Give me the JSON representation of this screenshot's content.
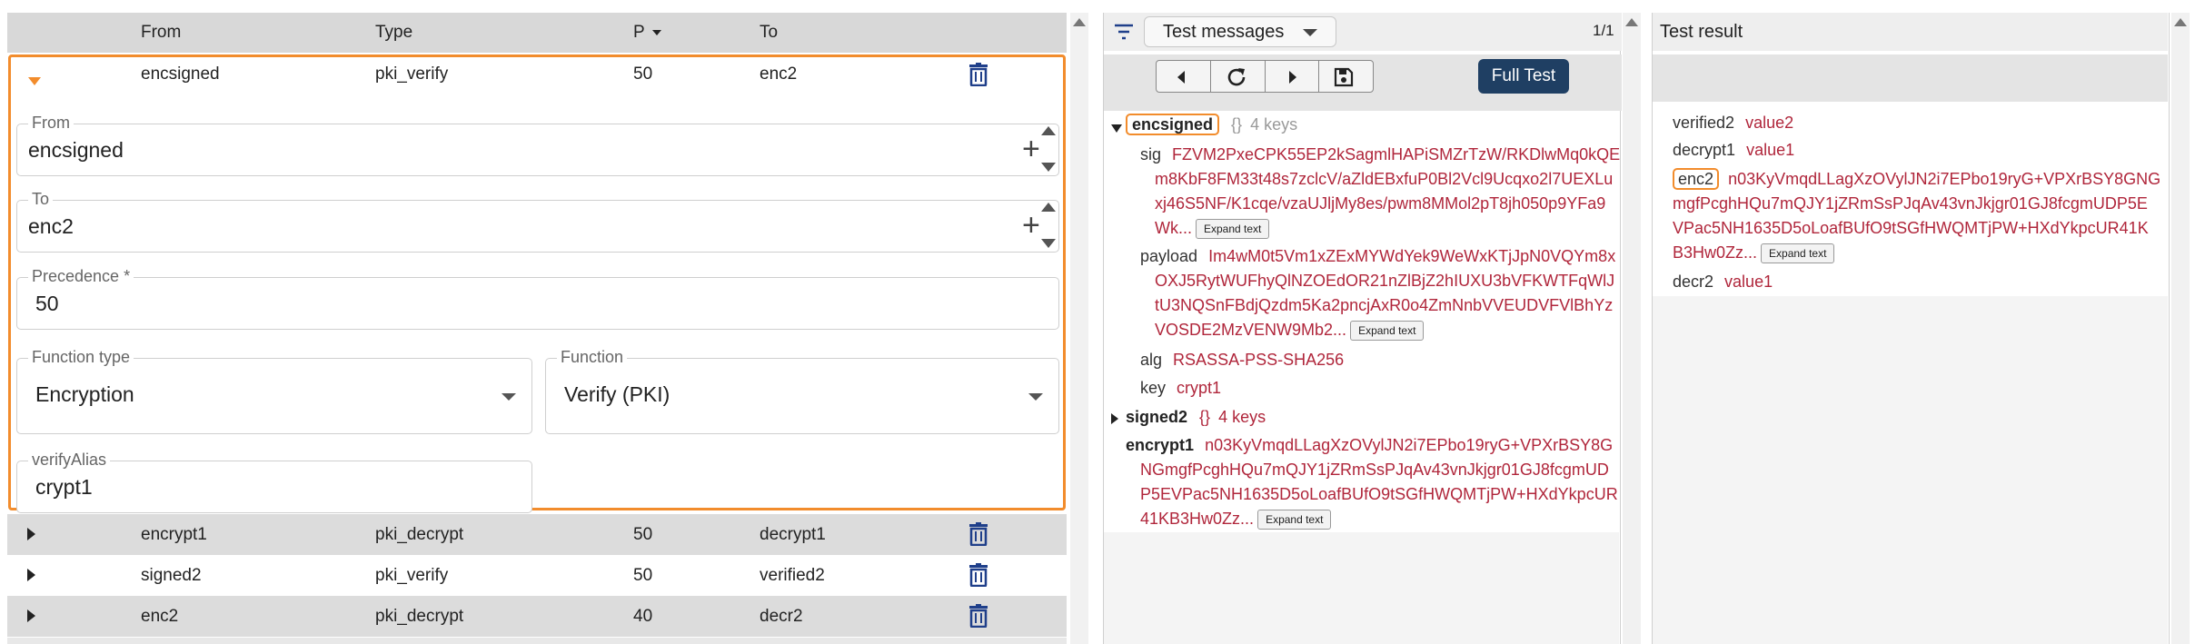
{
  "table": {
    "headers": {
      "from": "From",
      "type": "Type",
      "precedence": "P",
      "to": "To"
    },
    "expanded_row": {
      "from": "encsigned",
      "type": "pki_verify",
      "precedence": "50",
      "to": "enc2"
    },
    "form": {
      "from_label": "From",
      "from_value": "encsigned",
      "to_label": "To",
      "to_value": "enc2",
      "precedence_label": "Precedence *",
      "precedence_value": "50",
      "function_type_label": "Function type",
      "function_type_value": "Encryption",
      "function_label": "Function",
      "function_value": "Verify (PKI)",
      "verify_alias_label": "verifyAlias",
      "verify_alias_value": "crypt1"
    },
    "rows": [
      {
        "from": "encrypt1",
        "type": "pki_decrypt",
        "precedence": "50",
        "to": "decrypt1"
      },
      {
        "from": "signed2",
        "type": "pki_verify",
        "precedence": "50",
        "to": "verified2"
      },
      {
        "from": "enc2",
        "type": "pki_decrypt",
        "precedence": "40",
        "to": "decr2"
      }
    ]
  },
  "messages": {
    "select_label": "Test messages",
    "counter": "1/1",
    "full_test_label": "Full Test",
    "expand_label": "Expand text",
    "encsigned": {
      "name": "encsigned",
      "braces": "{}",
      "count": "4 keys",
      "sig_key": "sig",
      "sig_line1": "FZVM2PxeCPK55EP2kSagmlHAPiSMZrTzW/RKDlwMq0kQE",
      "sig_line2": "m8KbF8FM33t48s7zclcV/aZldEBxfuP0Bl2Vcl9Ucqxo2l7UEXLu",
      "sig_line3": "xj46S5NF/K1cqe/vzaUJljMy8es/pwm8MMol2pT8jh050p9YFa9",
      "sig_line4": "Wk...",
      "payload_key": "payload",
      "payload_line1": "Im4wM0t5Vm1xZExMYWdYek9WeWxKTjJpN0VQYm8x",
      "payload_line2": "OXJ5RytWUFhyQlNZOEdOR21nZlBjZ2hIUXU3bVFKWTFqWlJ",
      "payload_line3": "tU3NQSnFBdjQzdm5Ka2pncjAxR0o4ZmNnbVVEUDVFVlBhYz",
      "payload_line4": "VOSDE2MzVENW9Mb2...",
      "alg_key": "alg",
      "alg_value": "RSASSA-PSS-SHA256",
      "key_key": "key",
      "key_value": "crypt1"
    },
    "signed2": {
      "name": "signed2",
      "braces": "{}",
      "count": "4 keys"
    },
    "encrypt1": {
      "name": "encrypt1",
      "line1": "n03KyVmqdLLagXzOVylJN2i7EPbo19ryG+VPXrBSY8G",
      "line2": "NGmgfPcghHQu7mQJY1jZRmSsPJqAv43vnJkjgr01GJ8fcgmUD",
      "line3": "P5EVPac5NH1635D5oLoafBUfO9tSGfHWQMTjPW+HXdYkpcUR",
      "line4": "41KB3Hw0Zz..."
    }
  },
  "result": {
    "title": "Test result",
    "verified2_key": "verified2",
    "verified2_value": "value2",
    "decrypt1_key": "decrypt1",
    "decrypt1_value": "value1",
    "enc2_key": "enc2",
    "enc2_line1": "n03KyVmqdLLagXzOVylJN2i7EPbo19ryG+VPXrBSY8GNG",
    "enc2_line2": "mgfPcghHQu7mQJY1jZRmSsPJqAv43vnJkjgr01GJ8fcgmUDP5E",
    "enc2_line3": "VPac5NH1635D5oLoafBUfO9tSGfHWQMTjPW+HXdYkpcUR41K",
    "enc2_line4": "B3Hw0Zz...",
    "decr2_key": "decr2",
    "decr2_value": "value1"
  }
}
